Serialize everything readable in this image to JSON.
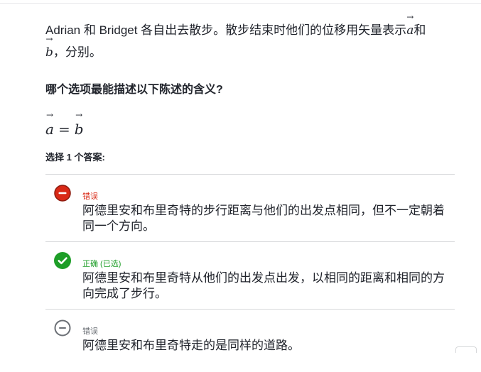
{
  "intro": {
    "text_before": "Adrian 和 Bridget 各自出去散步。散步结束时他们的位移用矢量表示",
    "vector_a": "a",
    "text_mid": "和",
    "vector_b": "b",
    "text_after": "，分别。"
  },
  "question": "哪个选项最能描述以下陈述的含义?",
  "equation": {
    "left": "a",
    "operator": "=",
    "right": "b"
  },
  "prompt": "选择 1 个答案:",
  "choices": [
    {
      "status": "错误",
      "text": "阿德里安和布里奇特的步行距离与他们的出发点相同，但不一定朝着同一个方向。",
      "icon": "minus-circle-red-icon"
    },
    {
      "status": "正确 (已选)",
      "text": "阿德里安和布里奇特从他们的出发点出发，以相同的距离和相同的方向完成了步行。",
      "icon": "checkmark-circle-green-icon"
    },
    {
      "status": "错误",
      "text": "阿德里安和布里奇特走的是同样的道路。",
      "icon": "minus-circle-gray-icon"
    }
  ],
  "colors": {
    "wrong": "#d92916",
    "correct": "#1e9e28",
    "neutral": "#6b6f75"
  }
}
